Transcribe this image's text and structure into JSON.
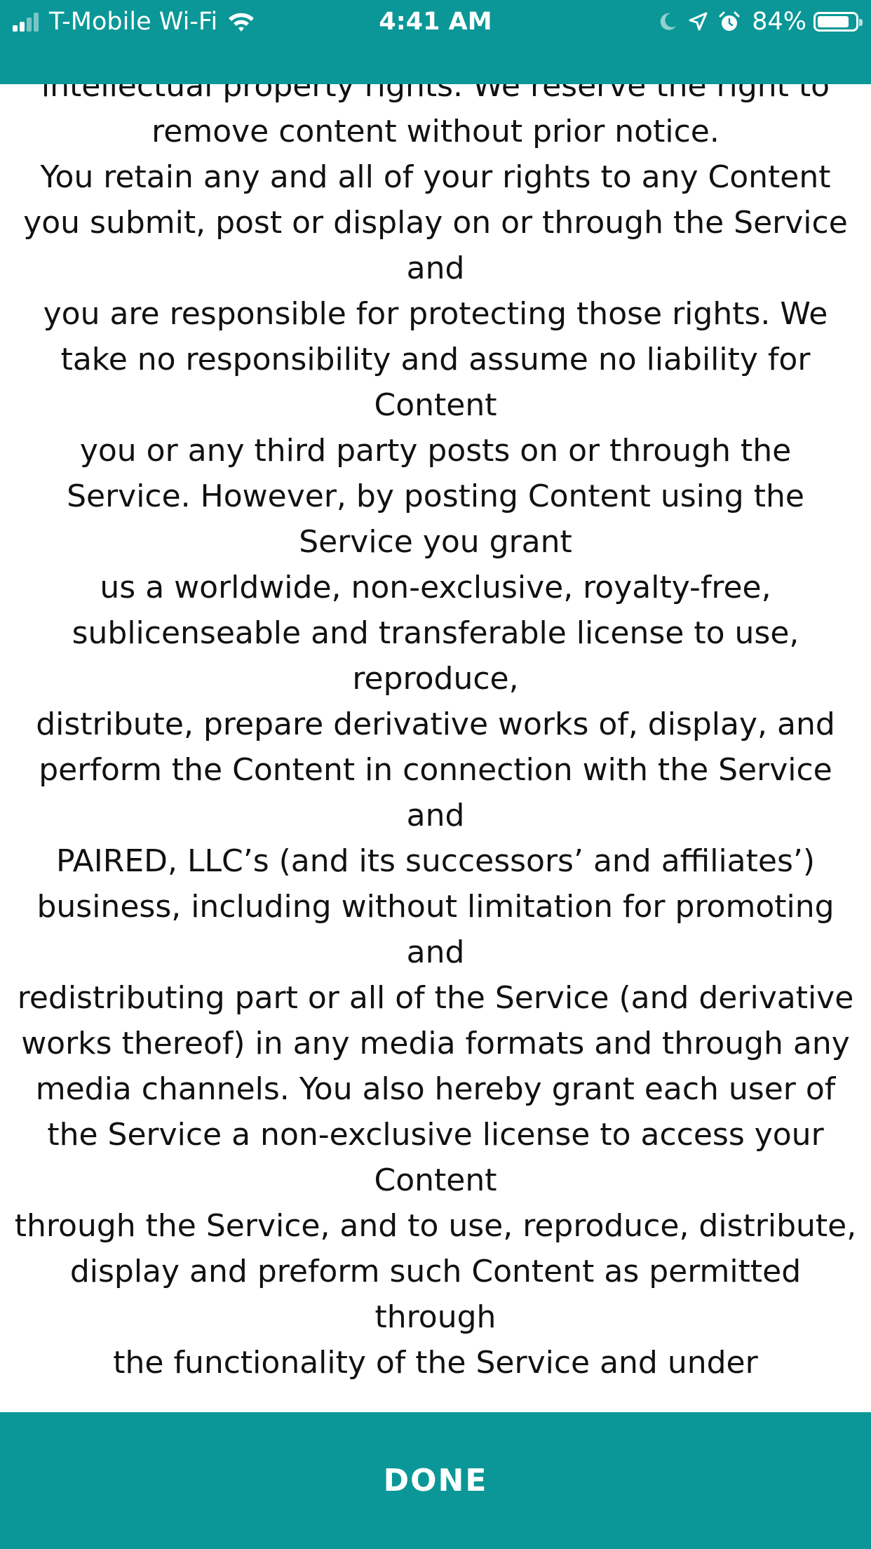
{
  "status_bar": {
    "carrier": "T-Mobile Wi-Fi",
    "time": "4:41 AM",
    "battery_percent": "84%",
    "battery_level": 0.84,
    "icons": [
      "signal-icon",
      "wifi-icon",
      "moon-icon",
      "location-icon",
      "alarm-icon",
      "battery-icon"
    ]
  },
  "content": {
    "text": "   intellectual property rights. We reserve the right to remove content without prior notice.\n   You retain any and all of your rights to any Content you submit, post or display on or through the Service and\n   you are responsible for protecting those rights. We take no responsibility and assume no liability for Content\n   you or any third party posts on or through the Service. However, by posting Content using the Service you grant\n   us a worldwide, non-exclusive, royalty-free, sublicenseable and transferable license to use, reproduce,\n   distribute, prepare derivative works of, display, and perform the Content in connection with the Service and\n   PAIRED, LLC’s (and its successors’ and affiliates’) business, including without limitation for promoting and\n   redistributing part or all of the Service (and derivative works thereof) in any media formats and through any\n   media channels. You also hereby grant each user of the Service a non-exclusive license to access your Content\n   through the Service, and to use, reproduce, distribute, display and preform such Content as permitted through\n   the functionality of the Service and under"
  },
  "footer": {
    "done_label": "DONE"
  },
  "colors": {
    "accent": "#0b9797",
    "background": "#ffffff",
    "text": "#111111"
  }
}
